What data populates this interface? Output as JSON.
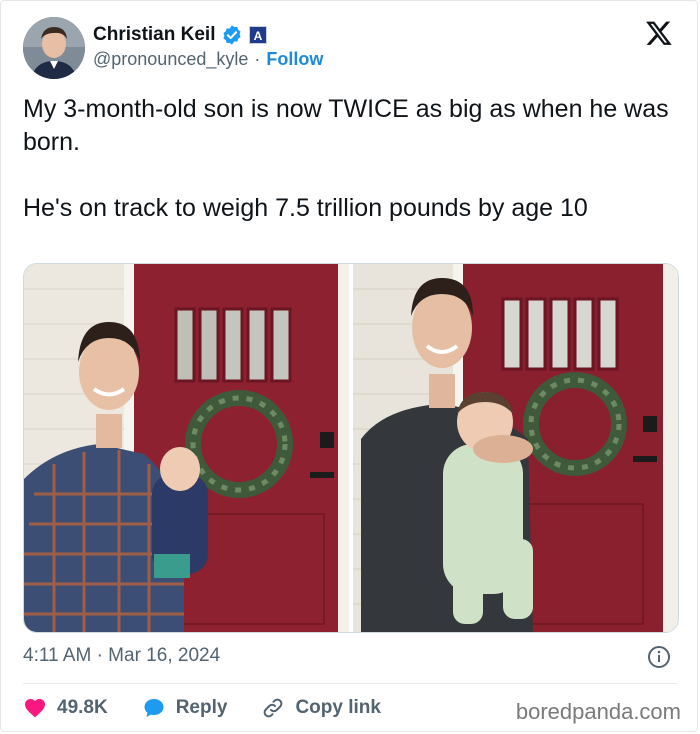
{
  "author": {
    "display_name": "Christian Keil",
    "handle": "@pronounced_kyle",
    "separator": "·",
    "follow_label": "Follow",
    "affiliate_badge_letter": "A"
  },
  "tweet": {
    "paragraphs": [
      "My 3-month-old son is now TWICE as big as when he was born.",
      "He's on track to weigh 7.5 trillion pounds by age 10"
    ]
  },
  "meta": {
    "timestamp": "4:11 AM · Mar 16, 2024"
  },
  "actions": {
    "likes": "49.8K",
    "reply_label": "Reply",
    "copy_link_label": "Copy link"
  },
  "watermark": "boredpanda.com",
  "colors": {
    "text": "#0f1419",
    "muted": "#536471",
    "accent": "#1d9bf0",
    "like": "#f91880",
    "door": "#8e2130"
  },
  "icons": [
    "verified-badge-icon",
    "affiliate-badge-icon",
    "x-logo-icon",
    "info-icon",
    "heart-icon",
    "reply-bubble-icon",
    "link-icon"
  ]
}
